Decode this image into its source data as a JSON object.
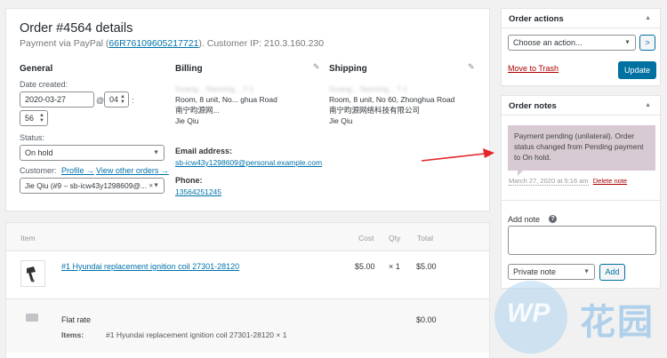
{
  "order": {
    "title": "Order #4564 details",
    "payment_prefix": "Payment via PayPal (",
    "transaction_id": "66R76109605217721",
    "payment_suffix": "). Customer IP: 210.3.160.230"
  },
  "general": {
    "heading": "General",
    "date_label": "Date created:",
    "date_value": "2020-03-27",
    "at": "@",
    "hour_value": "04",
    "colon": ":",
    "minute_value": "56",
    "status_label": "Status:",
    "status_value": "On hold",
    "customer_label": "Customer:",
    "profile_link": "Profile →",
    "other_orders_link": "View other orders →",
    "customer_value": "Jie Qiu (#9 – sb-icw43y1298609@..."
  },
  "billing": {
    "heading": "Billing",
    "addr_line1": "Guang... Nanning, , 7-1",
    "addr_line2": "Room, 8 unit, No... ghua Road",
    "addr_line3": "南宁昀源网...",
    "addr_line4": "Jie Qiu",
    "email_label": "Email address:",
    "email_value": "sb-icw43y1298609@personal.example.com",
    "phone_label": "Phone:",
    "phone_value": "13564251245"
  },
  "shipping": {
    "heading": "Shipping",
    "addr_line1": "Guang... Nanning, , 7-1",
    "addr_line2": "Room, 8 unit, No 60, Zhonghua Road",
    "addr_line3": "南宁昀源网络科技有限公司",
    "addr_line4": "Jie Qiu"
  },
  "items": {
    "col_item": "Item",
    "col_cost": "Cost",
    "col_qty": "Qty",
    "col_total": "Total",
    "product_name": "#1 Hyundai replacement ignition coil 27301-28120",
    "product_cost": "$5.00",
    "product_qty": "× 1",
    "product_total": "$5.00",
    "shipping_name": "Flat rate",
    "shipping_total": "$0.00",
    "shipping_items_label": "Items:",
    "shipping_items_value": "#1 Hyundai replacement ignition coil 27301-28120 × 1"
  },
  "order_actions": {
    "title": "Order actions",
    "select_placeholder": "Choose an action...",
    "go_label": ">",
    "trash_link": "Move to Trash",
    "update_button": "Update"
  },
  "order_notes": {
    "title": "Order notes",
    "note_text": "Payment pending (unilateral). Order status changed from Pending payment to On hold.",
    "note_meta": "March 27, 2020 at 5:16 am",
    "delete_link": "Delete note",
    "add_note_label": "Add note",
    "note_type": "Private note",
    "add_button": "Add"
  },
  "watermark": {
    "logo_text": "WP",
    "brand_text": "花园"
  },
  "icons": {
    "collapse": "triangle-up-icon",
    "pencil": "pencil-icon",
    "help": "help-icon",
    "truck": "truck-icon"
  },
  "colors": {
    "link": "#0073aa",
    "primary": "#0071a1",
    "note_bg": "#d7cad2",
    "trash": "#a00",
    "arrow": "#e3242b"
  }
}
